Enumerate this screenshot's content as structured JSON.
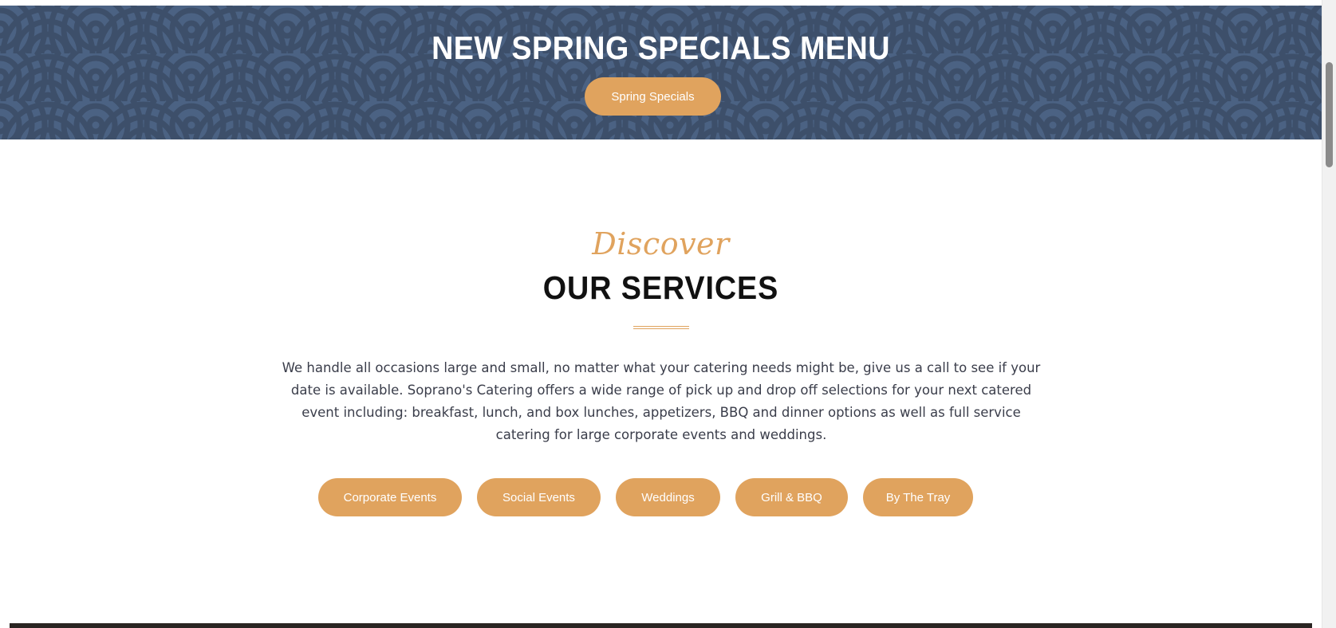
{
  "banner": {
    "title": "NEW SPRING SPECIALS MENU",
    "button_label": "Spring Specials",
    "background_color": "#4b6283",
    "pattern_color": "#3d4f6a"
  },
  "services_section": {
    "kicker": "Discover",
    "title": "OUR SERVICES",
    "intro": "We handle all occasions large and small, no matter what your catering needs might be, give us a call to see if your date is available. Soprano's Catering offers a wide range of pick up and drop off selections for your next catered event including: breakfast, lunch, and box lunches, appetizers, BBQ and dinner options as well as full service catering for large corporate events and weddings.",
    "buttons": [
      {
        "label": "Corporate Events"
      },
      {
        "label": "Social Events"
      },
      {
        "label": "Weddings"
      },
      {
        "label": "Grill & BBQ"
      },
      {
        "label": "By The Tray"
      }
    ]
  },
  "colors": {
    "accent": "#e0a35e",
    "heading": "#111111",
    "body_text": "#3a3d4a"
  }
}
